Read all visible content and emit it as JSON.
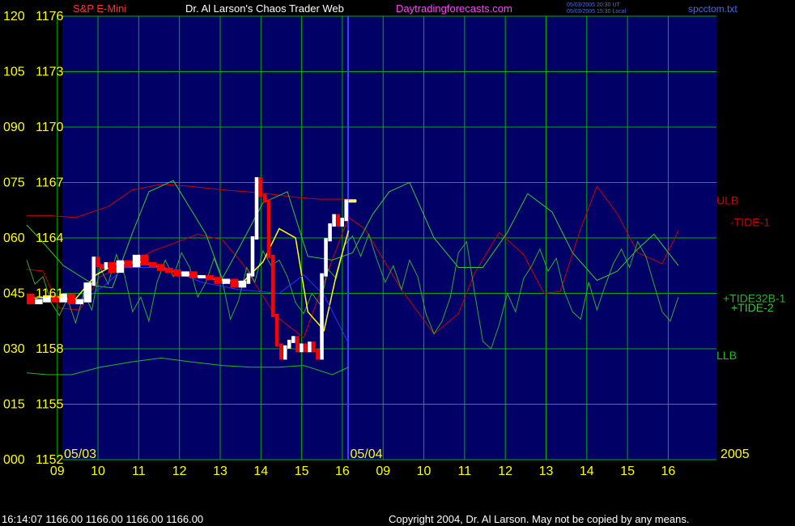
{
  "header": {
    "left": "S&P E-Mini",
    "center": "Dr. Al Larson's Chaos Trader Web",
    "site": "Daytradingforecasts.com",
    "small1": "05/03/2005 20:30 UT",
    "small2": "05/03/2005 15:30 Local",
    "file": "spcctom.txt"
  },
  "footer": {
    "status": "16:14:07   1166.00 1166.00 1166.00 1166.00",
    "copyright": "Copyright 2004, Dr. Al Larson. May not be copied by any means."
  },
  "colors": {
    "background": "#000000",
    "plot_background": "#000066",
    "grid": "#00b000",
    "axis_labels": "#ffff00",
    "day_divider": "#4040ff",
    "price_up": "#ffffff",
    "price_down": "#ff0000",
    "ulb": "#cc0000",
    "llb": "#22bb22",
    "tide1": "#cc0000",
    "tide2": "#33cc33",
    "tide32b1": "#33aa33",
    "average": "#ffff00",
    "blue_line": "#3030ff",
    "header_white": "#ffffff",
    "header_red": "#ff3333",
    "header_magenta": "#ff44ff",
    "header_blue": "#4466ff"
  },
  "chart_data": {
    "type": "line",
    "title": "S&P E-Mini",
    "y_labels": [
      {
        "index": "120",
        "price": "1176"
      },
      {
        "index": "105",
        "price": "1173"
      },
      {
        "index": "090",
        "price": "1170"
      },
      {
        "index": "075",
        "price": "1167"
      },
      {
        "index": "060",
        "price": "1164"
      },
      {
        "index": "045",
        "price": "1161"
      },
      {
        "index": "030",
        "price": "1158"
      },
      {
        "index": "015",
        "price": "1155"
      },
      {
        "index": "000",
        "price": "1152"
      }
    ],
    "ylim": [
      1152,
      1176
    ],
    "xlim": [
      0,
      16
    ],
    "x_ticks": [
      {
        "x": 0.75,
        "label": "09"
      },
      {
        "x": 1.75,
        "label": "10"
      },
      {
        "x": 2.75,
        "label": "11"
      },
      {
        "x": 3.75,
        "label": "12"
      },
      {
        "x": 4.75,
        "label": "13"
      },
      {
        "x": 5.75,
        "label": "14"
      },
      {
        "x": 6.75,
        "label": "15"
      },
      {
        "x": 7.75,
        "label": "16"
      },
      {
        "x": 8.75,
        "label": "09"
      },
      {
        "x": 9.75,
        "label": "10"
      },
      {
        "x": 10.75,
        "label": "11"
      },
      {
        "x": 11.75,
        "label": "12"
      },
      {
        "x": 12.75,
        "label": "13"
      },
      {
        "x": 13.75,
        "label": "14"
      },
      {
        "x": 14.75,
        "label": "15"
      },
      {
        "x": 15.75,
        "label": "16"
      }
    ],
    "grid": true,
    "date_labels": [
      {
        "x": 0,
        "label": "05/03"
      },
      {
        "x": 7.9,
        "label": "05/04"
      }
    ],
    "year_label": "2005",
    "series_labels": [
      {
        "text": "ULB",
        "value": 1166.0
      },
      {
        "text": "-TIDE-1",
        "value": 1164.8
      },
      {
        "text": "+TIDE32B-1",
        "value": 1160.7
      },
      {
        "text": "+TIDE-2",
        "value": 1160.2
      },
      {
        "text": "LLB",
        "value": 1157.6
      }
    ],
    "series": [
      {
        "name": "ULB",
        "color": "#cc0000",
        "x": [
          0,
          0.6,
          1.2,
          2.0,
          2.6,
          3.3,
          4.0,
          4.8,
          5.4,
          5.9,
          6.6,
          7.2,
          7.9
        ],
        "y": [
          1165.2,
          1165.2,
          1165.1,
          1165.7,
          1166.6,
          1166.9,
          1166.8,
          1166.6,
          1166.5,
          1166.4,
          1166.2,
          1166.1,
          1166.1
        ]
      },
      {
        "name": "LLB",
        "color": "#22bb22",
        "x": [
          0,
          0.5,
          1.1,
          1.8,
          2.6,
          3.3,
          4.0,
          4.8,
          5.5,
          6.2,
          6.8,
          7.5,
          7.9
        ],
        "y": [
          1156.7,
          1156.6,
          1156.6,
          1157.0,
          1157.3,
          1157.5,
          1157.3,
          1157.1,
          1157.0,
          1157.0,
          1157.1,
          1156.6,
          1157.0
        ]
      },
      {
        "name": "-TIDE-1",
        "color": "#cc0000",
        "x": [
          0,
          0.4,
          0.8,
          1.3,
          1.8,
          2.4,
          3.1,
          3.6,
          4.2,
          4.8,
          5.3,
          6.1,
          6.8,
          7.5,
          7.9,
          8.3,
          9.2,
          10.0,
          10.6,
          11.0,
          11.6,
          12.2,
          12.7,
          13.1,
          13.6,
          14.0,
          14.5,
          15.0,
          15.6,
          16.0
        ],
        "y": [
          1162.3,
          1162.2,
          1160.2,
          1160.1,
          1161.9,
          1162.5,
          1163.3,
          1163.7,
          1164.2,
          1163.9,
          1162.6,
          1159.8,
          1158.6,
          1162.8,
          1165.1,
          1164.5,
          1161.2,
          1158.8,
          1159.9,
          1162.1,
          1164.3,
          1163.1,
          1161.0,
          1161.1,
          1164.5,
          1166.8,
          1165.3,
          1163.2,
          1162.6,
          1164.4
        ]
      },
      {
        "name": "+TIDE-2",
        "color": "#33cc33",
        "x": [
          0,
          0.3,
          0.9,
          1.7,
          2.1,
          2.6,
          3.0,
          3.6,
          4.4,
          4.8,
          5.2,
          5.8,
          6.4,
          6.9,
          7.5,
          8.0,
          8.5,
          8.9,
          9.4,
          10.0,
          10.6,
          11.2,
          11.8,
          12.3,
          12.9,
          13.4,
          14.0,
          14.5,
          15.0,
          15.4,
          16.0
        ],
        "y": [
          1164.7,
          1164.0,
          1162.5,
          1161.4,
          1161.3,
          1164.3,
          1166.5,
          1167.1,
          1164.2,
          1161.8,
          1163.4,
          1165.9,
          1166.5,
          1163.0,
          1162.8,
          1163.2,
          1165.3,
          1166.5,
          1167.0,
          1164.0,
          1162.4,
          1162.4,
          1164.3,
          1166.4,
          1165.4,
          1163.2,
          1161.7,
          1162.2,
          1163.4,
          1164.2,
          1162.5
        ]
      },
      {
        "name": "+TIDE32B-1",
        "color": "#33aa33",
        "x": [
          0,
          0.2,
          0.4,
          0.6,
          0.8,
          1.0,
          1.2,
          1.4,
          1.6,
          1.8,
          2.0,
          2.2,
          2.4,
          2.6,
          2.8,
          3.0,
          3.2,
          3.4,
          3.6,
          3.8,
          4.0,
          4.2,
          4.4,
          4.6,
          4.8,
          5.0,
          5.2,
          5.4,
          5.6,
          5.8,
          6.0,
          6.2,
          6.4,
          6.6,
          6.8,
          7.0,
          7.2,
          7.4,
          7.6,
          7.8,
          8.0,
          8.2,
          8.4,
          8.6,
          8.8,
          9.0,
          9.2,
          9.4,
          9.6,
          9.8,
          10.0,
          10.2,
          10.4,
          10.6,
          10.8,
          11.0,
          11.2,
          11.4,
          11.6,
          11.8,
          12.0,
          12.2,
          12.4,
          12.6,
          12.8,
          13.0,
          13.2,
          13.4,
          13.6,
          13.8,
          14.0,
          14.2,
          14.4,
          14.6,
          14.8,
          15.0,
          15.2,
          15.4,
          15.6,
          15.8,
          16.0
        ],
        "y": [
          1162.8,
          1161.5,
          1161.9,
          1160.5,
          1159.8,
          1160.7,
          1159.4,
          1161.0,
          1160.1,
          1162.4,
          1161.5,
          1163.1,
          1162.0,
          1160.0,
          1160.8,
          1159.5,
          1161.6,
          1162.8,
          1161.9,
          1163.2,
          1162.4,
          1160.8,
          1161.6,
          1162.9,
          1161.7,
          1159.6,
          1160.6,
          1162.4,
          1161.6,
          1163.3,
          1162.5,
          1162.8,
          1161.9,
          1160.5,
          1159.9,
          1161.0,
          1160.4,
          1162.3,
          1161.8,
          1163.6,
          1164.1,
          1163.0,
          1164.2,
          1162.8,
          1161.6,
          1162.5,
          1161.2,
          1162.8,
          1161.9,
          1159.9,
          1158.8,
          1159.5,
          1160.8,
          1163.2,
          1163.8,
          1161.0,
          1158.4,
          1158.0,
          1159.3,
          1161.0,
          1160.0,
          1161.8,
          1162.5,
          1163.4,
          1162.2,
          1162.9,
          1161.1,
          1160.0,
          1159.6,
          1161.6,
          1160.1,
          1161.4,
          1162.6,
          1163.4,
          1162.4,
          1163.8,
          1163.0,
          1161.5,
          1160.0,
          1159.5,
          1160.8
        ]
      },
      {
        "name": "average",
        "color": "#ffff00",
        "x": [
          0,
          0.5,
          1.2,
          1.7,
          2.2,
          2.8,
          3.6,
          4.5,
          5.3,
          5.8,
          6.2,
          6.6,
          6.9,
          7.3,
          7.6,
          7.9
        ],
        "y": [
          1160.7,
          1160.8,
          1160.7,
          1162.0,
          1162.6,
          1162.7,
          1162.2,
          1161.8,
          1161.6,
          1162.7,
          1164.5,
          1164.0,
          1160.0,
          1159.0,
          1162.0,
          1164.4
        ]
      },
      {
        "name": "blue",
        "color": "#3030ff",
        "x": [
          0,
          0.6,
          1.3,
          1.9,
          2.4,
          3.4,
          4.3,
          5.2,
          6.2,
          6.8,
          7.3,
          7.9
        ],
        "y": [
          1160.9,
          1160.6,
          1160.5,
          1161.4,
          1162.4,
          1162.4,
          1161.6,
          1161.2,
          1161.0,
          1162.0,
          1160.9,
          1158.3
        ]
      },
      {
        "name": "price_day1",
        "color": "#ffffff",
        "x": [
          0.0,
          0.2,
          0.4,
          0.6,
          0.8,
          1.0,
          1.2,
          1.4,
          1.6,
          1.7,
          1.8,
          1.9,
          2.0,
          2.2,
          2.4,
          2.6,
          2.8,
          3.0,
          3.2,
          3.4,
          3.6,
          3.8,
          4.0,
          4.2,
          4.4,
          4.6,
          4.8,
          5.0,
          5.2,
          5.4,
          5.5,
          5.6,
          5.7,
          5.8,
          5.9,
          6.0,
          6.1,
          6.2,
          6.3,
          6.4,
          6.5,
          6.6,
          6.7,
          6.8,
          6.9,
          7.0,
          7.1,
          7.2,
          7.3,
          7.4,
          7.5,
          7.6,
          7.7,
          7.8,
          7.9,
          8.1
        ],
        "y": [
          1160.9,
          1160.5,
          1160.6,
          1160.8,
          1160.6,
          1160.9,
          1160.5,
          1160.6,
          1161.5,
          1162.9,
          1162.5,
          1162.4,
          1162.6,
          1162.2,
          1162.7,
          1162.5,
          1163.0,
          1162.6,
          1162.5,
          1162.3,
          1162.2,
          1162.0,
          1162.1,
          1161.9,
          1161.9,
          1161.8,
          1161.6,
          1161.7,
          1161.4,
          1161.6,
          1162.0,
          1164.0,
          1167.2,
          1166.3,
          1166.0,
          1163.0,
          1159.8,
          1158.2,
          1157.5,
          1158.1,
          1158.4,
          1158.6,
          1157.9,
          1158.2,
          1157.9,
          1158.3,
          1157.9,
          1157.5,
          1162.0,
          1163.9,
          1164.7,
          1165.2,
          1164.7,
          1165.0,
          1166.0,
          1166.0
        ]
      }
    ]
  }
}
